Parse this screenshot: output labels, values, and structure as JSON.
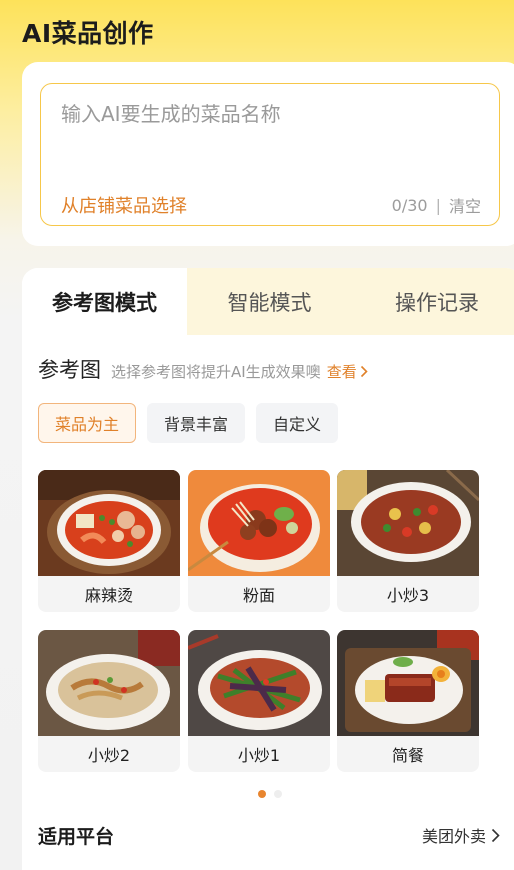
{
  "header": {
    "title": "AI菜品创作"
  },
  "input": {
    "placeholder": "输入AI要生成的菜品名称",
    "value": "",
    "store_link": "从店铺菜品选择",
    "counter": "0/30",
    "separator": "|",
    "clear_label": "清空"
  },
  "tabs": [
    {
      "label": "参考图模式",
      "active": true
    },
    {
      "label": "智能模式",
      "active": false
    },
    {
      "label": "操作记录",
      "active": false
    }
  ],
  "reference": {
    "title": "参考图",
    "hint": "选择参考图将提升AI生成效果噢",
    "view_link": "查看"
  },
  "chips": [
    {
      "label": "菜品为主",
      "active": true
    },
    {
      "label": "背景丰富",
      "active": false
    },
    {
      "label": "自定义",
      "active": false
    }
  ],
  "tiles": [
    {
      "caption": "麻辣烫",
      "icon": "spicy-hotpot-photo"
    },
    {
      "caption": "粉面",
      "icon": "noodle-bowl-photo"
    },
    {
      "caption": "小炒3",
      "icon": "stir-fry-3-photo"
    },
    {
      "caption": "小炒2",
      "icon": "stir-fry-2-photo"
    },
    {
      "caption": "小炒1",
      "icon": "stir-fry-1-photo"
    },
    {
      "caption": "简餐",
      "icon": "simple-meal-photo"
    }
  ],
  "pagination": {
    "pages": 2,
    "current": 1
  },
  "platform": {
    "title": "适用平台",
    "value": "美团外卖"
  },
  "colors": {
    "accent": "#e0812a",
    "header_yellow": "#fde25a",
    "input_border": "#f6c74a",
    "tab_inactive_bg": "#fdf6dc"
  }
}
